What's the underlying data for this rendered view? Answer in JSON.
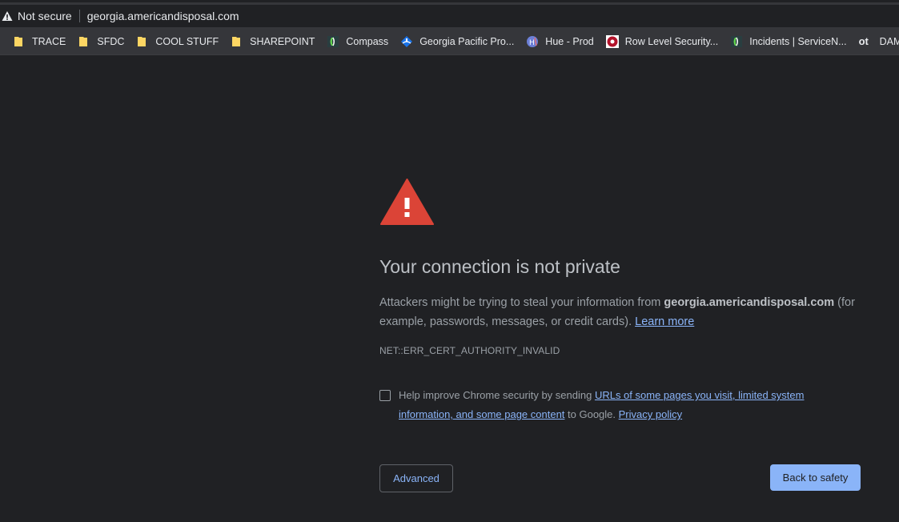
{
  "addressbar": {
    "security_label": "Not secure",
    "url": "georgia.americandisposal.com"
  },
  "bookmarks": [
    {
      "label": "TRACE",
      "icon": "folder-icon"
    },
    {
      "label": "SFDC",
      "icon": "folder-icon"
    },
    {
      "label": "COOL STUFF",
      "icon": "folder-icon"
    },
    {
      "label": "SHAREPOINT",
      "icon": "folder-icon"
    },
    {
      "label": "Compass",
      "icon": "servicenow-icon"
    },
    {
      "label": "Georgia Pacific Pro...",
      "icon": "gp-logo-icon"
    },
    {
      "label": "Hue - Prod",
      "icon": "hue-icon"
    },
    {
      "label": "Row Level Security...",
      "icon": "red-circle-icon"
    },
    {
      "label": "Incidents | ServiceN...",
      "icon": "servicenow-icon"
    },
    {
      "label": "DAM",
      "icon": "ot-icon",
      "icon_text": "ot"
    }
  ],
  "main": {
    "title": "Your connection is not private",
    "explanation_prefix": "Attackers might be trying to steal your information from ",
    "explanation_host": "georgia.americandisposal.com",
    "explanation_suffix": " (for example, passwords, messages, or credit cards). ",
    "learn_more": "Learn more",
    "error_code": "NET::ERR_CERT_AUTHORITY_INVALID",
    "optin_prefix": "Help improve Chrome security by sending ",
    "optin_link": "URLs of some pages you visit, limited system information, and some page content",
    "optin_middle": " to Google. ",
    "privacy_link": "Privacy policy",
    "advanced_label": "Advanced",
    "back_label": "Back to safety"
  },
  "colors": {
    "background": "#202124",
    "warning_red": "#db4437",
    "link_blue": "#8ab4f8",
    "primary_button": "#8ab4f8"
  }
}
